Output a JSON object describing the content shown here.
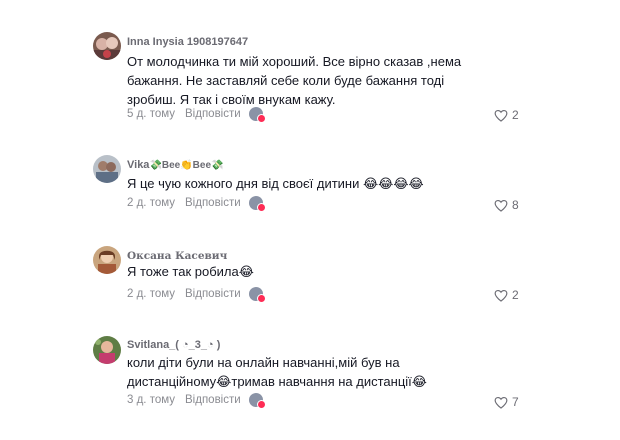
{
  "comments": [
    {
      "username": "Inna Inysia 1908197647",
      "text": "От молодчинка ти мій хороший. Все вірно сказав ,нема бажання. Не заставляй себе коли буде бажання тоді зробиш. Я так і своїм внукам кажу.",
      "age": "5 д. тому",
      "reply": "Відповісти",
      "likes": "2"
    },
    {
      "username": "Vika",
      "username_emoji": "💸Bee👏Bee💸",
      "text": "Я це чую кожного дня від своєї дитини",
      "text_emoji": "😂😂😂😂",
      "age": "2 д. тому",
      "reply": "Відповісти",
      "likes": "8"
    },
    {
      "username": "Оксана Касевич",
      "text": "Я тоже так робила",
      "text_emoji": "😂",
      "age": "2 д. тому",
      "reply": "Відповісти",
      "likes": "2"
    },
    {
      "username": "Svitlana_( ◔_3_◔ )",
      "text_part1": "коли діти були на онлайн навчанні,мій був на дистанційному",
      "text_emoji1": "😂",
      "text_part2": "тримав навчання на дистанції",
      "text_emoji2": "😂",
      "age": "3 д. тому",
      "reply": "Відповісти",
      "likes": "7"
    }
  ],
  "icons": {
    "like": "heart-outline-icon",
    "creator_liked": "creator-avatar-heart-icon"
  },
  "colors": {
    "text": "#161823",
    "muted": "#8a8b91",
    "accent": "#fe2c55"
  }
}
